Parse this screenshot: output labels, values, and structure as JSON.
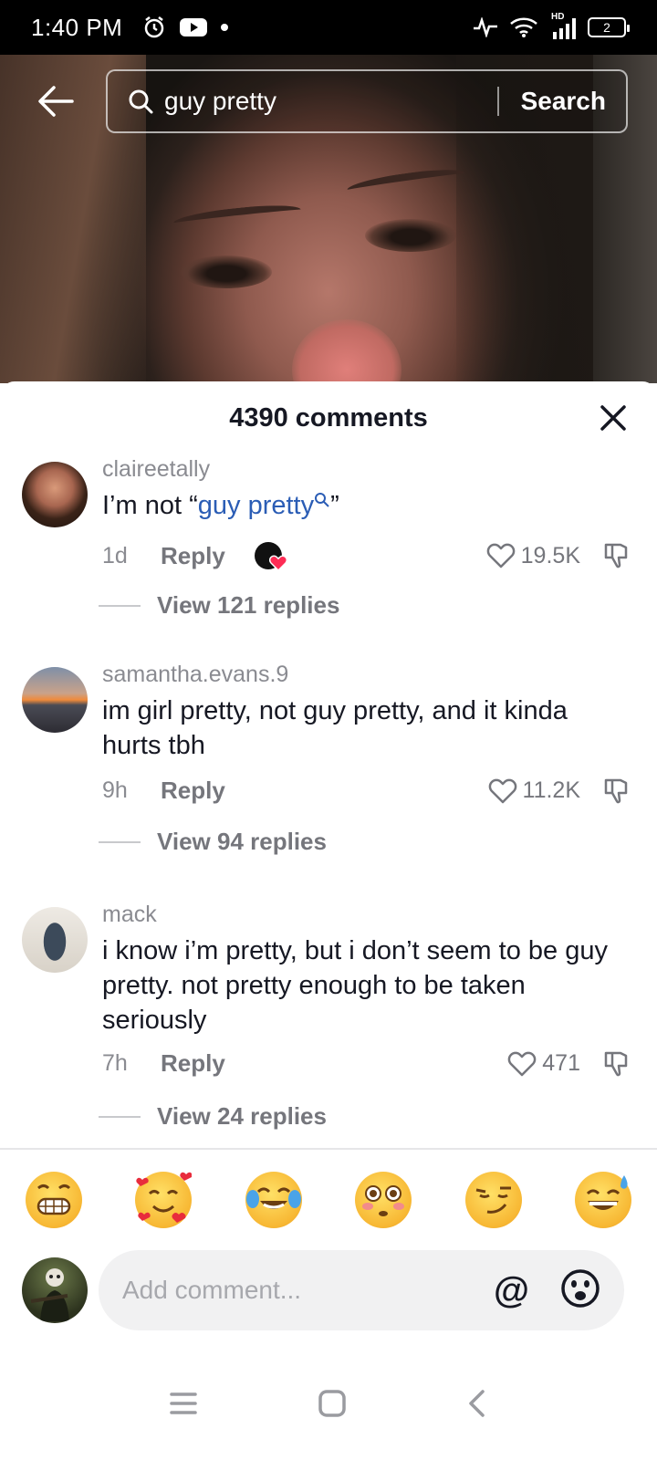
{
  "status_bar": {
    "time": "1:40 PM",
    "hd_label": "HD",
    "battery_level": "2"
  },
  "search": {
    "query": "guy pretty",
    "button_label": "Search"
  },
  "comments_header": {
    "title": "4390 comments"
  },
  "comments": [
    {
      "username": "claireetally",
      "text_prefix": "I’m not “",
      "text_highlight": "guy pretty",
      "text_suffix": "”",
      "time": "1d",
      "reply_label": "Reply",
      "likes": "19.5K",
      "view_replies": "View 121 replies"
    },
    {
      "username": "samantha.evans.9",
      "text": "im girl pretty, not guy pretty, and it kinda hurts tbh",
      "time": "9h",
      "reply_label": "Reply",
      "likes": "11.2K",
      "view_replies": "View 94 replies"
    },
    {
      "username": "mack",
      "text": "i know i’m pretty, but i don’t seem to be guy pretty. not pretty enough to be taken seriously",
      "time": "7h",
      "reply_label": "Reply",
      "likes": "471",
      "view_replies": "View 24 replies"
    }
  ],
  "emoji_bar": [
    "grinning-face",
    "smiling-face-with-hearts",
    "tears-of-joy",
    "flushed-face",
    "smirking-face",
    "grinning-sweat"
  ],
  "composer": {
    "placeholder": "Add comment...",
    "mention_symbol": "@"
  },
  "colors": {
    "highlight": "#2b5db5",
    "muted": "#8a8b91",
    "text": "#161823"
  }
}
